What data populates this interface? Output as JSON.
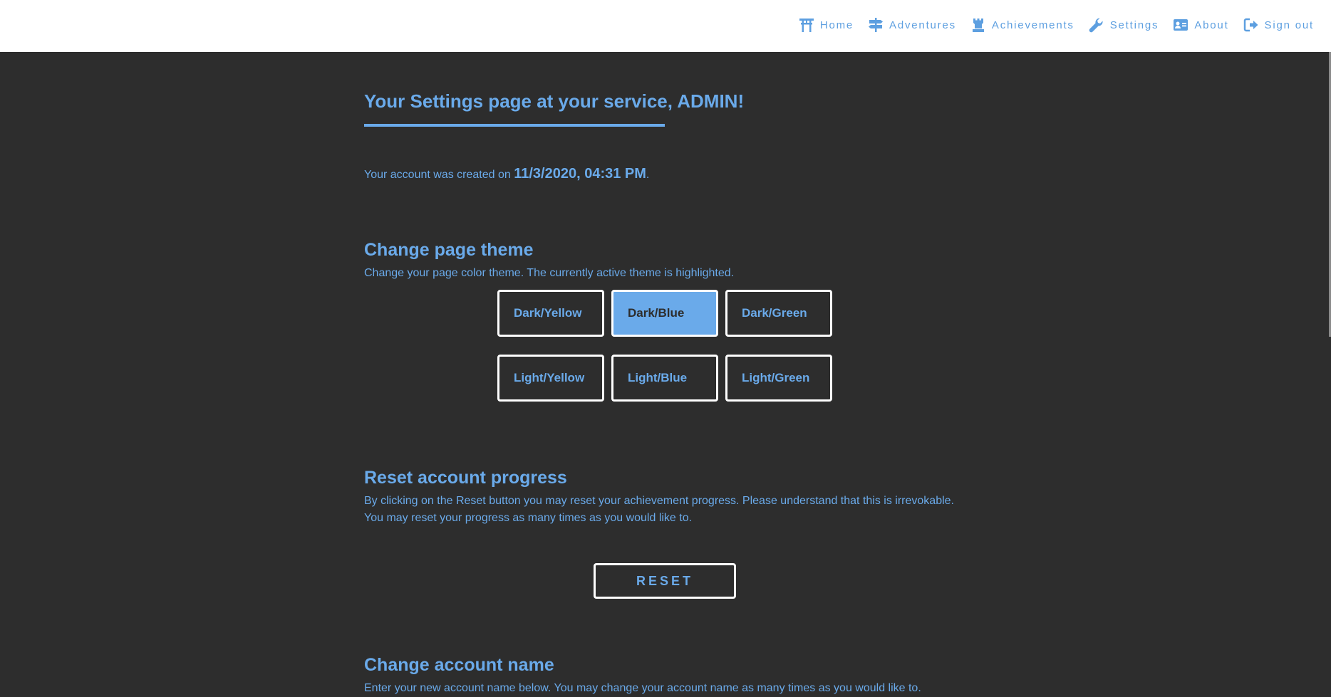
{
  "nav": {
    "items": [
      {
        "label": "Home",
        "icon": "torii-gate-icon"
      },
      {
        "label": "Adventures",
        "icon": "signpost-icon"
      },
      {
        "label": "Achievements",
        "icon": "chess-rook-icon"
      },
      {
        "label": "Settings",
        "icon": "wrench-icon"
      },
      {
        "label": "About",
        "icon": "id-card-icon"
      },
      {
        "label": "Sign out",
        "icon": "sign-out-icon"
      }
    ]
  },
  "header": {
    "title": "Your Settings page at your service, ADMIN!"
  },
  "account": {
    "created_prefix": "Your account was created on ",
    "created_date": "11/3/2020, 04:31 PM",
    "created_suffix": "."
  },
  "theme": {
    "heading": "Change page theme",
    "description": "Change your page color theme. The currently active theme is highlighted.",
    "options": [
      "Dark/Yellow",
      "Dark/Blue",
      "Dark/Green",
      "Light/Yellow",
      "Light/Blue",
      "Light/Green"
    ],
    "active": "Dark/Blue"
  },
  "reset": {
    "heading": "Reset account progress",
    "line1": "By clicking on the Reset button you may reset your achievement progress. Please understand that this is irrevokable.",
    "line2": "You may reset your progress as many times as you would like to.",
    "button_label": "RESET"
  },
  "rename": {
    "heading": "Change account name",
    "description": "Enter your new account name below. You may change your account name as many times as you would like to."
  },
  "colors": {
    "accent": "#6aaaea",
    "background": "#2d2d2d",
    "topbar": "#ffffff"
  }
}
